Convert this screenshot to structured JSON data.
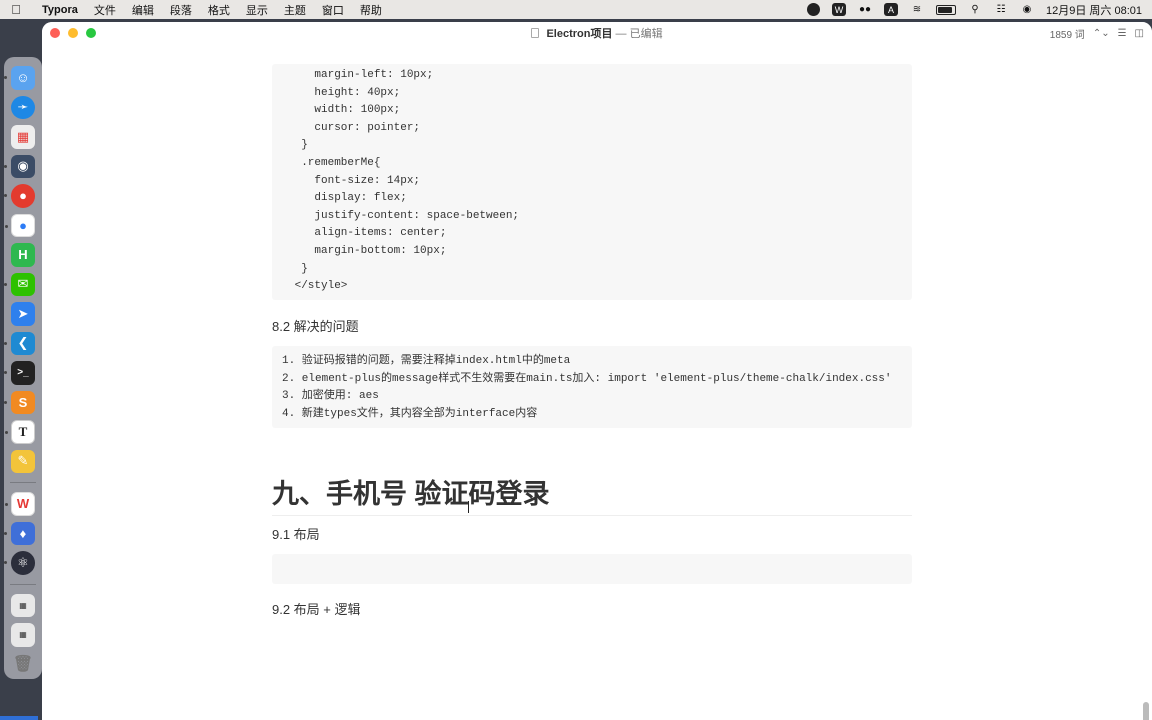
{
  "menubar": {
    "apple": "",
    "app_name": "Typora",
    "menus": [
      "文件",
      "编辑",
      "段落",
      "格式",
      "显示",
      "主题",
      "窗口",
      "帮助"
    ],
    "clock": "12月9日 周六  08:01"
  },
  "window": {
    "title": "Electron项目",
    "separator": "—",
    "status": "已编辑",
    "word_count": "1859 词",
    "word_count_arrows": "⌃⌄"
  },
  "code_block_1": {
    "lines": [
      "    margin-left: 10px;",
      "    height: 40px;",
      "    width: 100px;",
      "    cursor: pointer;",
      "  }",
      "  .rememberMe{",
      "    font-size: 14px;",
      "    display: flex;",
      "    justify-content: space-between;",
      "    align-items: center;",
      "    margin-bottom: 10px;",
      "  }",
      " </style>"
    ]
  },
  "section_8_2": {
    "heading": "8.2 解决的问题"
  },
  "code_block_2": {
    "lines": [
      "1. 验证码报错的问题，需要注释掉index.html中的meta",
      "2. element-plus的message样式不生效需要在main.ts加入: import 'element-plus/theme-chalk/index.css'",
      "3. 加密使用: aes",
      "4. 新建types文件，其内容全部为interface内容"
    ]
  },
  "chapter_9": {
    "heading": "九、手机号 验证码登录"
  },
  "section_9_1": {
    "heading": "9.1 布局"
  },
  "section_9_2": {
    "heading": "9.2 布局 + 逻辑"
  },
  "dock": {
    "apps": [
      "finder",
      "safari",
      "launchpad",
      "screen-recorder",
      "chrome",
      "baidu-netdisk",
      "hbuilder",
      "wechat",
      "feishu",
      "vscode",
      "terminal",
      "sublime-text",
      "typora",
      "color-picker",
      "wps",
      "clash",
      "electron",
      "document-1",
      "document-2",
      "trash"
    ]
  }
}
